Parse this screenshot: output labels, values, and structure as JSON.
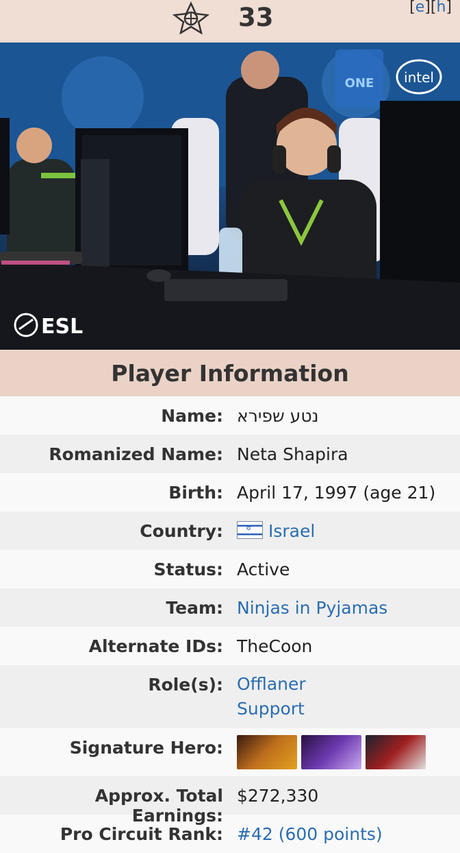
{
  "header": {
    "title": "33",
    "edit_e": "e",
    "edit_h": "h",
    "logo_icon": "ninjas-in-pyjamas-logo-icon"
  },
  "photo": {
    "watermark_text": "ESL"
  },
  "section": {
    "title": "Player Information"
  },
  "info": {
    "name_label": "Name:",
    "name_value": "נטע שפירא",
    "romanized_label": "Romanized Name:",
    "romanized_value": "Neta Shapira",
    "birth_label": "Birth:",
    "birth_value": "April 17, 1997 (age 21)",
    "country_label": "Country:",
    "country_value": "Israel",
    "status_label": "Status:",
    "status_value": "Active",
    "team_label": "Team:",
    "team_value": "Ninjas in Pyjamas",
    "alt_ids_label": "Alternate IDs:",
    "alt_ids_value": "TheCoon",
    "roles_label": "Role(s):",
    "roles": [
      "Offlaner",
      "Support"
    ],
    "signature_label": "Signature Hero:",
    "signature_heroes": [
      "hero-portrait-1",
      "hero-portrait-2",
      "hero-portrait-3"
    ],
    "earnings_label": "Approx. Total Earnings:",
    "earnings_value": "$272,330",
    "rank_label": "Pro Circuit Rank:",
    "rank_value": "#42 (600 points)"
  },
  "colors": {
    "header_bg": "#f0ddd3",
    "section_bg": "#ead2c6",
    "link": "#2a6db0"
  }
}
